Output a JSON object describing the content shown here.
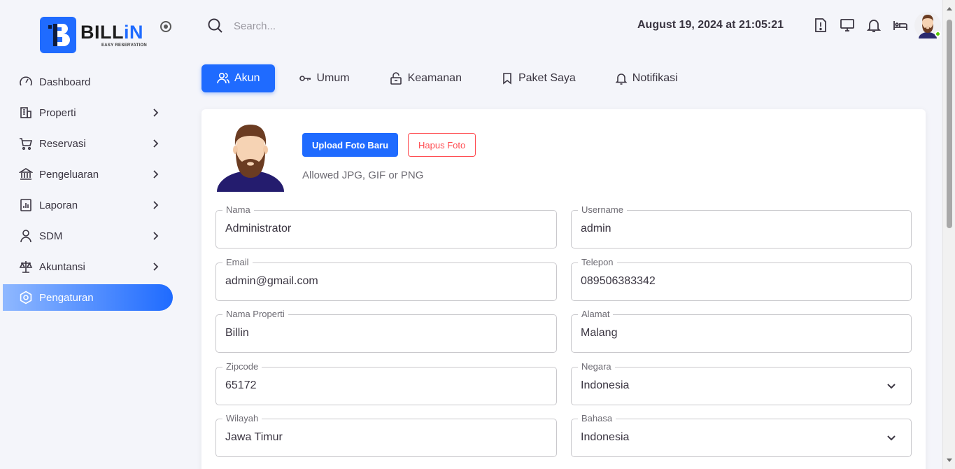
{
  "brand": {
    "name_part1": "BILL",
    "name_part2": "iN",
    "tagline": "EASY RESERVATION",
    "accent": "#1f6bff"
  },
  "search": {
    "placeholder": "Search..."
  },
  "header": {
    "datetime": "August 19, 2024 at 21:05:21",
    "icons": [
      "alert-icon",
      "monitor-icon",
      "bell-icon",
      "bed-icon"
    ],
    "online_status_color": "#56ca00"
  },
  "sidebar": {
    "items": [
      {
        "label": "Dashboard",
        "icon": "gauge-icon",
        "has_children": false
      },
      {
        "label": "Properti",
        "icon": "building-icon",
        "has_children": true
      },
      {
        "label": "Reservasi",
        "icon": "cart-icon",
        "has_children": true
      },
      {
        "label": "Pengeluaran",
        "icon": "bank-icon",
        "has_children": true
      },
      {
        "label": "Laporan",
        "icon": "report-icon",
        "has_children": true
      },
      {
        "label": "SDM",
        "icon": "user-icon",
        "has_children": true
      },
      {
        "label": "Akuntansi",
        "icon": "scale-icon",
        "has_children": true
      },
      {
        "label": "Pengaturan",
        "icon": "settings-icon",
        "has_children": false,
        "active": true
      }
    ]
  },
  "tabs": [
    {
      "label": "Akun",
      "icon": "users-icon",
      "active": true
    },
    {
      "label": "Umum",
      "icon": "key-icon"
    },
    {
      "label": "Keamanan",
      "icon": "lock-icon"
    },
    {
      "label": "Paket Saya",
      "icon": "bookmark-icon"
    },
    {
      "label": "Notifikasi",
      "icon": "bell-icon"
    }
  ],
  "profile": {
    "upload_label": "Upload Foto Baru",
    "delete_label": "Hapus Foto",
    "hint": "Allowed JPG, GIF or PNG"
  },
  "form": {
    "nama": {
      "label": "Nama",
      "value": "Administrator"
    },
    "username": {
      "label": "Username",
      "value": "admin"
    },
    "email": {
      "label": "Email",
      "value": "admin@gmail.com"
    },
    "telepon": {
      "label": "Telepon",
      "value": "089506383342"
    },
    "nama_properti": {
      "label": "Nama Properti",
      "value": "Billin"
    },
    "alamat": {
      "label": "Alamat",
      "value": "Malang"
    },
    "zipcode": {
      "label": "Zipcode",
      "value": "65172"
    },
    "negara": {
      "label": "Negara",
      "value": "Indonesia"
    },
    "wilayah": {
      "label": "Wilayah",
      "value": "Jawa Timur"
    },
    "bahasa": {
      "label": "Bahasa",
      "value": "Indonesia"
    }
  }
}
